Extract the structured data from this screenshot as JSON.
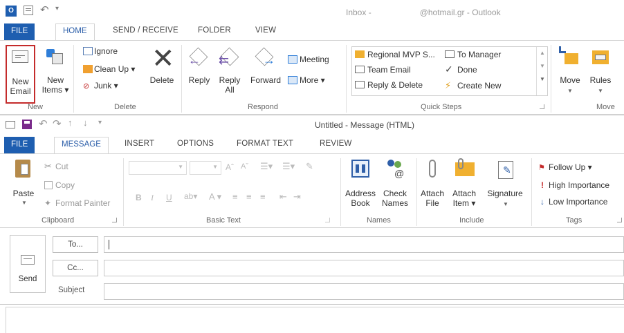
{
  "outlook": {
    "title_left": "Inbox -",
    "title_right": "@hotmail.gr - Outlook",
    "tabs": [
      "FILE",
      "HOME",
      "SEND / RECEIVE",
      "FOLDER",
      "VIEW"
    ],
    "groups": {
      "new": {
        "label": "New",
        "new_email": [
          "New",
          "Email"
        ],
        "new_items": [
          "New",
          "Items ▾"
        ]
      },
      "delete": {
        "label": "Delete",
        "ignore": "Ignore",
        "clean_up": "Clean Up ▾",
        "junk": "Junk ▾",
        "delete": "Delete"
      },
      "respond": {
        "label": "Respond",
        "reply": "Reply",
        "reply_all": [
          "Reply",
          "All"
        ],
        "forward": "Forward",
        "meeting": "Meeting",
        "more": "More ▾"
      },
      "quick_steps": {
        "label": "Quick Steps",
        "items": [
          "Regional MVP S...",
          "To Manager",
          "Team Email",
          "Done",
          "Reply & Delete",
          "Create New"
        ]
      },
      "move": {
        "label": "Move",
        "move": "Move",
        "rules": "Rules"
      }
    }
  },
  "message": {
    "window_title": "Untitled - Message (HTML)",
    "tabs": [
      "FILE",
      "MESSAGE",
      "INSERT",
      "OPTIONS",
      "FORMAT TEXT",
      "REVIEW"
    ],
    "groups": {
      "clipboard": {
        "label": "Clipboard",
        "paste": "Paste",
        "cut": "Cut",
        "copy": "Copy",
        "format_painter": "Format Painter"
      },
      "basic_text": {
        "label": "Basic Text"
      },
      "names": {
        "label": "Names",
        "address_book": [
          "Address",
          "Book"
        ],
        "check_names": [
          "Check",
          "Names"
        ]
      },
      "include": {
        "label": "Include",
        "attach_file": [
          "Attach",
          "File"
        ],
        "attach_item": [
          "Attach",
          "Item ▾"
        ],
        "signature": "Signature"
      },
      "tags": {
        "label": "Tags",
        "follow_up": "Follow Up ▾",
        "high_importance": "High Importance",
        "low_importance": "Low Importance"
      }
    },
    "compose": {
      "send": "Send",
      "to": "To...",
      "cc": "Cc...",
      "subject": "Subject"
    }
  },
  "colors": {
    "file_tab": "#1e5eb0",
    "highlight_box": "#c42b2b",
    "accent_blue": "#2a5da8"
  }
}
